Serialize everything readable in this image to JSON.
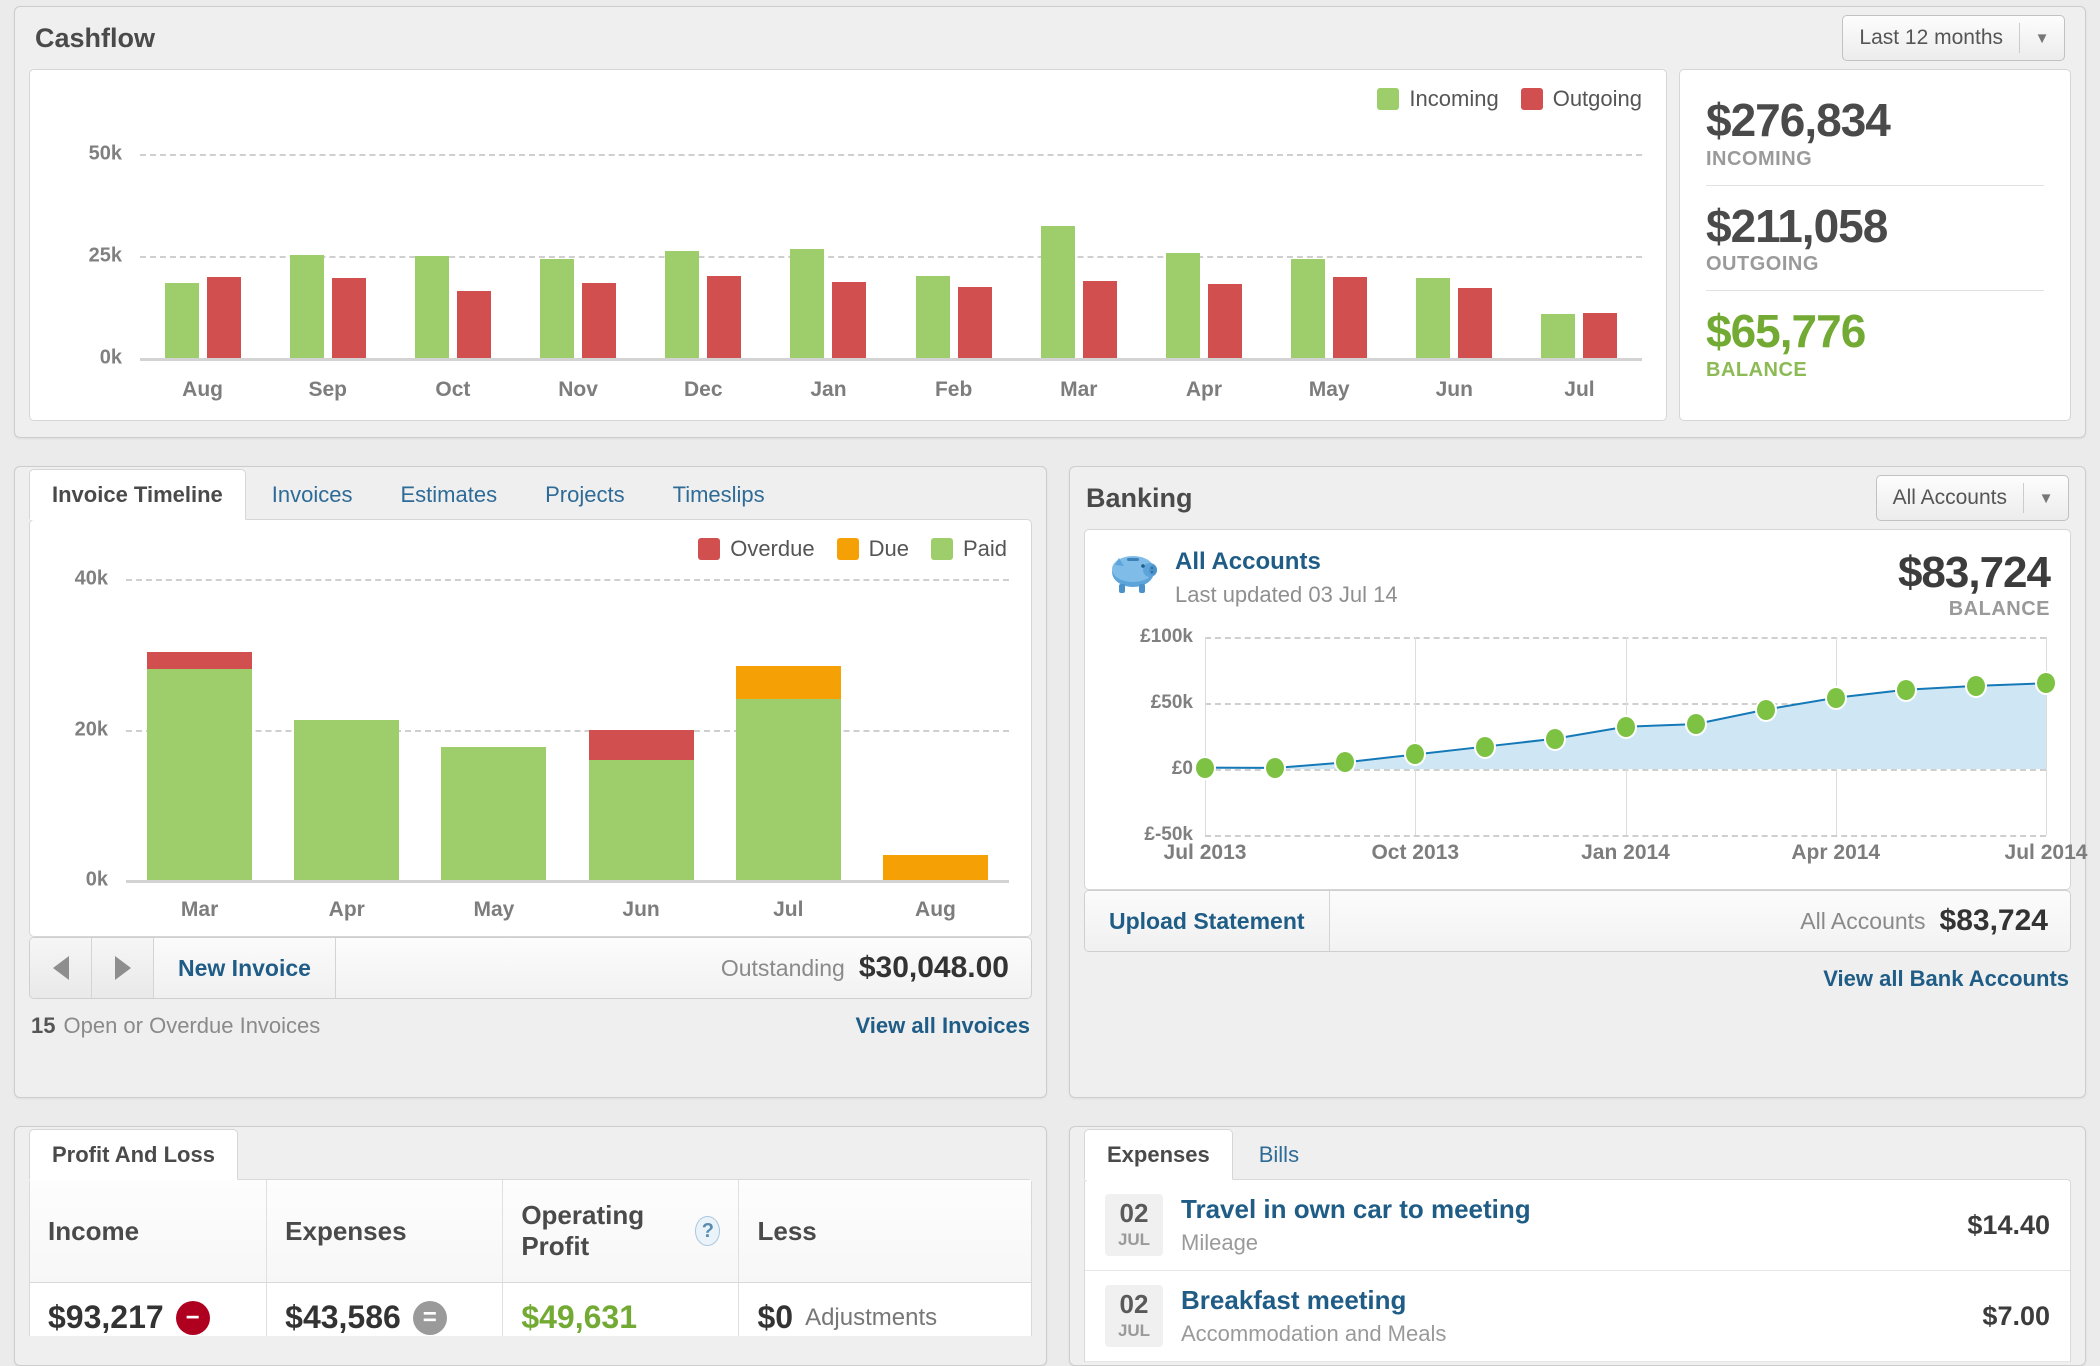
{
  "cashflow": {
    "title": "Cashflow",
    "period_selector": {
      "value": "Last 12 months",
      "caret": "chevron-down-icon"
    },
    "legend": [
      {
        "label": "Incoming",
        "color": "#9DCE6B"
      },
      {
        "label": "Outgoing",
        "color": "#D24F4F"
      }
    ],
    "stats": [
      {
        "value": "$276,834",
        "label": "INCOMING"
      },
      {
        "value": "$211,058",
        "label": "OUTGOING"
      },
      {
        "value": "$65,776",
        "label": "BALANCE"
      }
    ],
    "chart_data": {
      "type": "bar",
      "title": "Cashflow",
      "xlabel": "",
      "ylabel": "",
      "ylim": [
        0,
        56000
      ],
      "grid": true,
      "legend_position": "top-right",
      "ticks": [
        "0k",
        "25k",
        "50k"
      ],
      "tickvalues": [
        0,
        25000,
        50000
      ],
      "categories": [
        "Aug",
        "Sep",
        "Oct",
        "Nov",
        "Dec",
        "Jan",
        "Feb",
        "Mar",
        "Apr",
        "May",
        "Jun",
        "Jul"
      ],
      "series": [
        {
          "name": "Incoming",
          "color": "#9DCE6B",
          "values": [
            18500,
            25300,
            25000,
            24300,
            26200,
            26800,
            20200,
            32500,
            25800,
            24200,
            19700,
            10800
          ]
        },
        {
          "name": "Outgoing",
          "color": "#D24F4F",
          "values": [
            19800,
            19600,
            16500,
            18500,
            20100,
            18700,
            17500,
            19000,
            18300,
            20000,
            17300,
            11000
          ]
        }
      ]
    }
  },
  "invoice": {
    "tabs": [
      {
        "label": "Invoice Timeline",
        "active": true
      },
      {
        "label": "Invoices",
        "active": false
      },
      {
        "label": "Estimates",
        "active": false
      },
      {
        "label": "Projects",
        "active": false
      },
      {
        "label": "Timeslips",
        "active": false
      }
    ],
    "legend": [
      {
        "label": "Overdue",
        "color": "#D24F4F"
      },
      {
        "label": "Due",
        "color": "#F5A004"
      },
      {
        "label": "Paid",
        "color": "#9DCE6B"
      }
    ],
    "footer": {
      "prev_icon": "triangle-left-icon",
      "next_icon": "triangle-right-icon",
      "new_invoice": "New Invoice",
      "outstanding_label": "Outstanding",
      "outstanding_value": "$30,048.00"
    },
    "subfooter": {
      "count": "15",
      "text": "Open or Overdue Invoices",
      "link": "View all Invoices"
    },
    "chart_data": {
      "type": "bar",
      "stacked": true,
      "title": "Invoice Timeline",
      "xlabel": "",
      "ylabel": "",
      "ylim": [
        0,
        42000
      ],
      "grid": true,
      "legend_position": "top-right",
      "ticks": [
        "0k",
        "20k",
        "40k"
      ],
      "tickvalues": [
        0,
        20000,
        40000
      ],
      "categories": [
        "Mar",
        "Apr",
        "May",
        "Jun",
        "Jul",
        "Aug"
      ],
      "series": [
        {
          "name": "Paid",
          "color": "#9DCE6B",
          "values": [
            29500,
            22400,
            18600,
            16800,
            25400,
            0
          ]
        },
        {
          "name": "Due",
          "color": "#F5A004",
          "values": [
            0,
            0,
            0,
            0,
            4600,
            3500
          ]
        },
        {
          "name": "Overdue",
          "color": "#D24F4F",
          "values": [
            2400,
            0,
            0,
            4200,
            0,
            0
          ]
        }
      ]
    }
  },
  "banking": {
    "title": "Banking",
    "account_selector": {
      "value": "All Accounts",
      "caret": "chevron-down-icon"
    },
    "account": {
      "icon": "piggy-bank-icon",
      "name": "All Accounts",
      "updated": "Last updated 03 Jul 14",
      "balance": "$83,724",
      "balance_label": "BALANCE"
    },
    "footer": {
      "upload": "Upload Statement",
      "accounts_label": "All Accounts",
      "accounts_value": "$83,724",
      "link": "View all Bank Accounts"
    },
    "chart_data": {
      "type": "area",
      "title": "Banking balance",
      "xlabel": "",
      "ylabel": "",
      "ylim": [
        -50000,
        100000
      ],
      "grid": true,
      "line_color": "#1579B8",
      "fill_color": "#CFE7F5",
      "marker_color": "#7DC242",
      "ticks": [
        "£-50k",
        "£0",
        "£50k",
        "£100k"
      ],
      "tickvalues": [
        -50000,
        0,
        50000,
        100000
      ],
      "xticks": [
        "Jul 2013",
        "Oct 2013",
        "Jan 2014",
        "Apr 2014",
        "Jul 2014"
      ],
      "x": [
        "Jul 2013",
        "Aug 2013",
        "Sep 2013",
        "Oct 2013",
        "Nov 2013",
        "Dec 2013",
        "Jan 2014",
        "Feb 2014",
        "Mar 2014",
        "Apr 2014",
        "May 2014",
        "Jun 2014",
        "Jul 2014"
      ],
      "values": [
        1000,
        800,
        5000,
        11000,
        17000,
        23000,
        32000,
        34000,
        45000,
        54000,
        60000,
        63000,
        65000
      ]
    }
  },
  "pnl": {
    "tabs": [
      {
        "label": "Profit And Loss",
        "active": true
      }
    ],
    "columns": [
      "Income",
      "Expenses",
      "Operating Profit",
      "Less"
    ],
    "help_icon": "question-mark-icon",
    "values": [
      {
        "amount": "$93,217",
        "badge": "minus-icon",
        "badge_color": "#B00020"
      },
      {
        "amount": "$43,586",
        "badge": "equals-icon",
        "badge_color": "#9a9a9a"
      },
      {
        "amount": "$49,631",
        "badge": "",
        "badge_color": ""
      },
      {
        "amount": "$0",
        "suffix": "Adjustments"
      }
    ]
  },
  "expenses": {
    "tabs": [
      {
        "label": "Expenses",
        "active": true
      },
      {
        "label": "Bills",
        "active": false
      }
    ],
    "items": [
      {
        "day": "02",
        "month": "JUL",
        "title": "Travel in own car to meeting",
        "category": "Mileage",
        "amount": "$14.40"
      },
      {
        "day": "02",
        "month": "JUL",
        "title": "Breakfast meeting",
        "category": "Accommodation and Meals",
        "amount": "$7.00"
      }
    ]
  }
}
